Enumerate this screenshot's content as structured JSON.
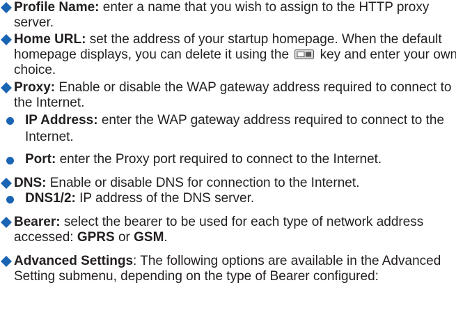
{
  "colors": {
    "accent": "#1a64b4",
    "text": "#231f20"
  },
  "icons": {
    "main_bullet": "diamond-icon",
    "sub_bullet": "circle-icon",
    "key": "menu-key-icon"
  },
  "entries": [
    {
      "term": "Profile Name:",
      "text": " enter a name that you wish to assign to the HTTP proxy server."
    },
    {
      "term": "Home URL:",
      "text_before_key": " set the address of your startup homepage. When the default homepage displays, you can delete it using the ",
      "text_after_key": " key and enter your own choice."
    },
    {
      "term": "Proxy:",
      "text": " Enable or disable the WAP gateway address required to connect to the Internet."
    },
    {
      "term": "IP Address:",
      "text": " enter the WAP gateway address required to connect to the Internet."
    },
    {
      "term": "Port:",
      "text": " enter the Proxy port required to connect to the Internet."
    },
    {
      "term": "DNS:",
      "text": " Enable or disable DNS for connection to the Internet."
    },
    {
      "term": "DNS1/2:",
      "text": " IP address of the DNS server."
    },
    {
      "term": "Bearer:",
      "text": " select the bearer to be used for each type of network address accessed: ",
      "option1": "GPRS",
      "connector": " or ",
      "option2": "GSM",
      "end": "."
    },
    {
      "term": "Advanced Settings",
      "text": ": The following options are available in the Advanced Setting submenu, depending on the type of Bearer configured:"
    }
  ]
}
